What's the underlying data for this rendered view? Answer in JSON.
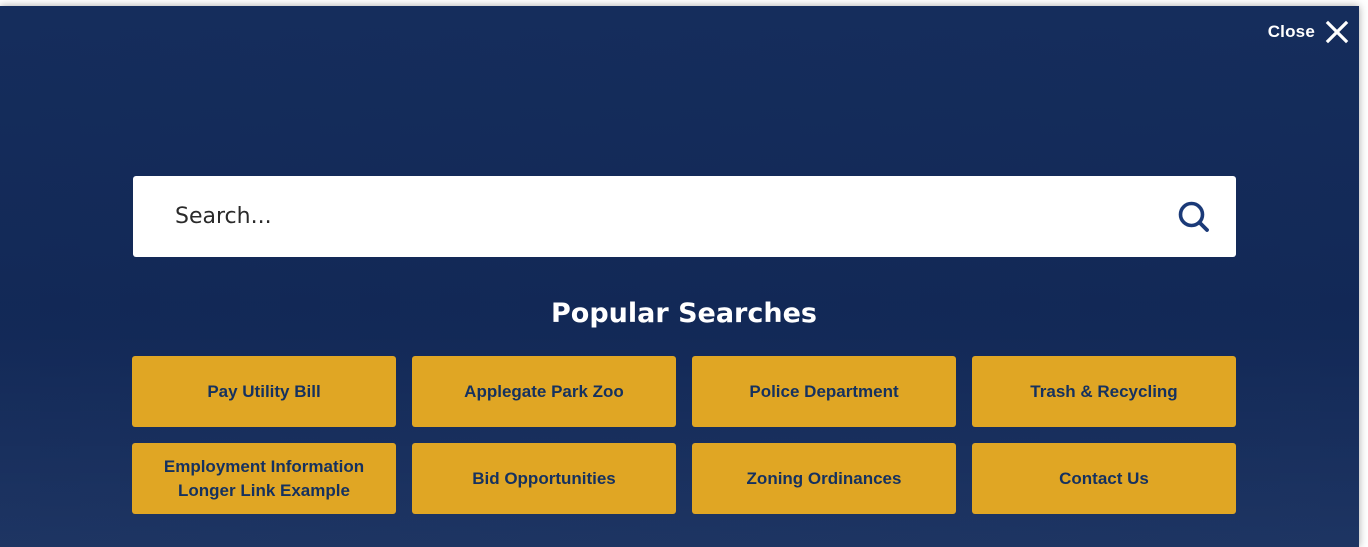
{
  "header": {
    "close_label": "Close",
    "close_icon": "close-icon"
  },
  "search": {
    "placeholder": "Search...",
    "value": "",
    "icon": "search-icon"
  },
  "popular": {
    "title": "Popular Searches",
    "links": [
      {
        "label": "Pay Utility Bill"
      },
      {
        "label": "Applegate Park Zoo"
      },
      {
        "label": "Police Department"
      },
      {
        "label": "Trash & Recycling"
      },
      {
        "label": "Employment Information\nLonger Link Example"
      },
      {
        "label": "Bid Opportunities"
      },
      {
        "label": "Zoning Ordinances"
      },
      {
        "label": "Contact Us"
      }
    ]
  },
  "colors": {
    "overlay_bg": "#17305f",
    "tile_bg": "#e0a624",
    "tile_text": "#15315f",
    "search_icon": "#1b3a78",
    "white": "#ffffff"
  }
}
